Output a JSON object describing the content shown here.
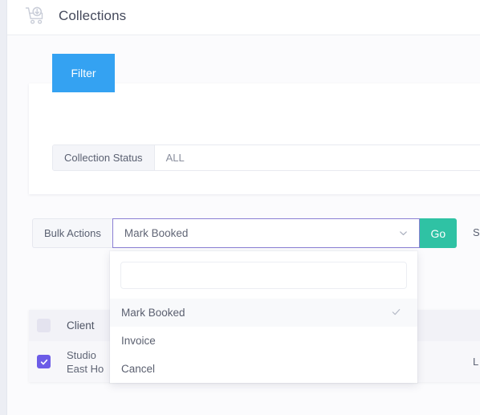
{
  "header": {
    "title": "Collections",
    "icon": "collections-cart-icon"
  },
  "filter_tab": {
    "label": "Filter"
  },
  "filter_card": {
    "status_field": {
      "label": "Collection Status",
      "value": "ALL"
    }
  },
  "bulk_actions": {
    "label": "Bulk Actions",
    "selected_value": "Mark Booked",
    "go_label": "Go",
    "chevron_icon": "chevron-down-icon",
    "trailing_cut_text": "S"
  },
  "dropdown": {
    "search_placeholder": "",
    "search_value": "",
    "check_icon": "check-icon",
    "options": [
      {
        "label": "Mark Booked",
        "selected": true
      },
      {
        "label": "Invoice",
        "selected": false
      },
      {
        "label": "Cancel",
        "selected": false
      }
    ]
  },
  "table": {
    "header": {
      "select_all_checkbox": "unchecked",
      "columns": [
        "Client"
      ]
    },
    "rows": [
      {
        "checkbox": "checked",
        "check_icon": "check-icon",
        "client_line1": "Studio",
        "client_line2": "East Ho",
        "trailing_cut_text": "L"
      }
    ]
  },
  "colors": {
    "filter_blue": "#34a2f2",
    "go_green": "#2fc2a4",
    "select_focus_purple": "#8b7fd4",
    "checkbox_purple": "#6c5ce7",
    "sidebar_strip": "#eceef4"
  }
}
